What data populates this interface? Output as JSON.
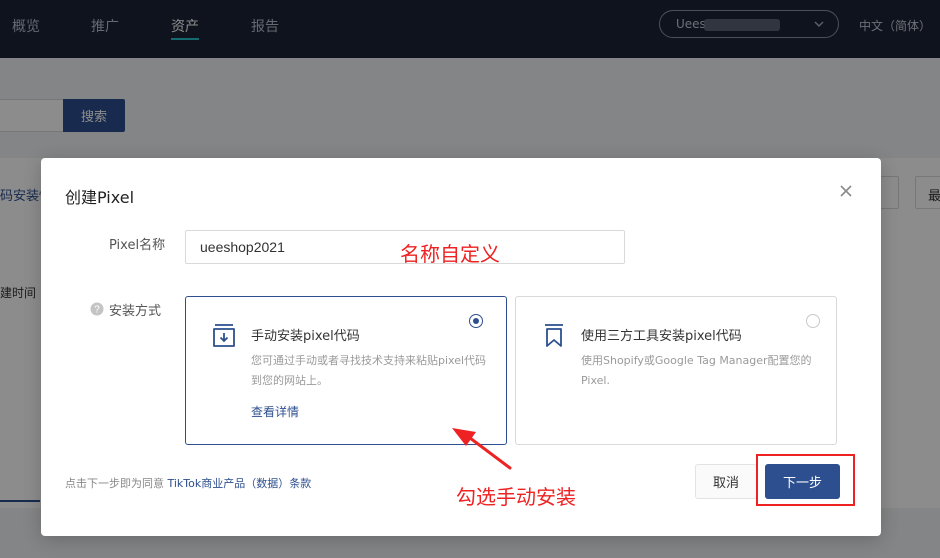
{
  "nav": {
    "items": [
      {
        "label": "概览",
        "active": false
      },
      {
        "label": "推广",
        "active": false
      },
      {
        "label": "资产",
        "active": true
      },
      {
        "label": "报告",
        "active": false
      }
    ],
    "account": "Uees",
    "language": "中文（简体）",
    "accent_color": "#25c2c9"
  },
  "background": {
    "search_button": "搜索",
    "link_text": "码安装情",
    "field_label": "建时间",
    "right_button": "最"
  },
  "modal": {
    "title": "创建Pixel",
    "close_icon": "close-icon",
    "pixel_name_label": "Pixel名称",
    "pixel_name_value": "ueeshop2021",
    "install_method_label": "安装方式",
    "options": [
      {
        "title": "手动安装pixel代码",
        "description": "您可通过手动或者寻找技术支持来粘贴pixel代码到您的网站上。",
        "link": "查看详情",
        "selected": true,
        "icon": "download-box-icon"
      },
      {
        "title": "使用三方工具安装pixel代码",
        "description": "使用Shopify或Google Tag Manager配置您的Pixel.",
        "selected": false,
        "icon": "bookmark-icon"
      }
    ],
    "agreement_prefix": "点击下一步即为同意",
    "agreement_link": "TikTok商业产品（数据）条款",
    "cancel": "取消",
    "next": "下一步",
    "primary_color": "#2d4f8f"
  },
  "annotations": {
    "name_hint": "名称自定义",
    "select_hint": "勾选手动安装",
    "color": "#ee2222"
  }
}
